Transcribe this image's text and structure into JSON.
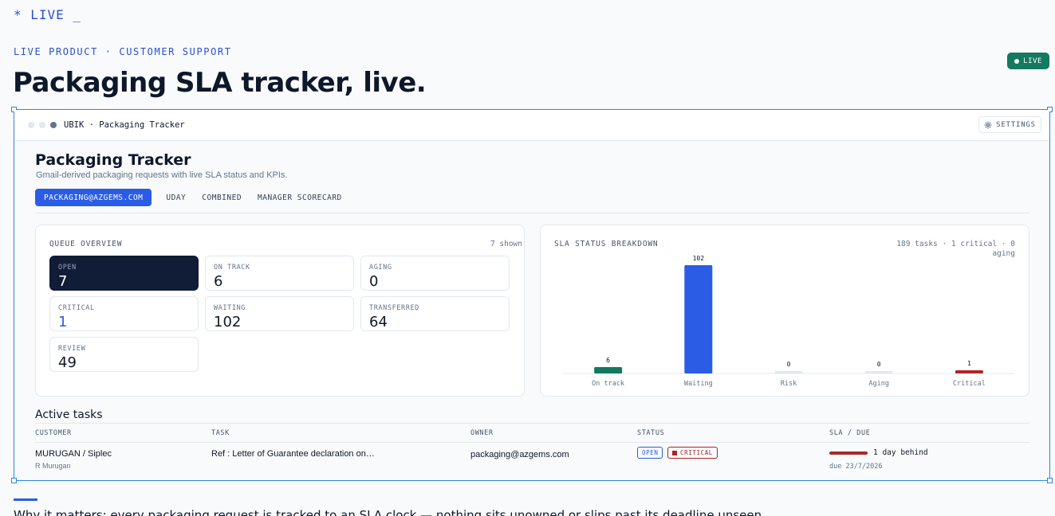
{
  "brand": "* LIVE _",
  "eyebrow": "LIVE PRODUCT · CUSTOMER SUPPORT",
  "page_title": "Packaging SLA tracker, live.",
  "live_badge": "LIVE",
  "app": {
    "name": "UBIK · Packaging Tracker",
    "settings_label": "SETTINGS"
  },
  "tracker": {
    "title": "Packaging Tracker",
    "subtitle": "Gmail-derived packaging requests with live SLA status and KPIs.",
    "tabs": [
      {
        "label": "PACKAGING@AZGEMS.COM",
        "active": true
      },
      {
        "label": "UDAY",
        "active": false
      },
      {
        "label": "COMBINED",
        "active": false
      },
      {
        "label": "MANAGER SCORECARD",
        "active": false
      }
    ]
  },
  "queue": {
    "label": "QUEUE OVERVIEW",
    "shown": "7 shown",
    "kpis": [
      {
        "label": "OPEN",
        "value": "7"
      },
      {
        "label": "ON TRACK",
        "value": "6"
      },
      {
        "label": "AGING",
        "value": "0"
      },
      {
        "label": "CRITICAL",
        "value": "1"
      },
      {
        "label": "WAITING",
        "value": "102"
      },
      {
        "label": "TRANSFERRED",
        "value": "64"
      },
      {
        "label": "REVIEW",
        "value": "49"
      }
    ]
  },
  "sla": {
    "label": "SLA STATUS BREAKDOWN",
    "meta_line1": "189 tasks · 1 critical · 0",
    "meta_line2": "aging"
  },
  "chart_data": {
    "type": "bar",
    "categories": [
      "On track",
      "Waiting",
      "Risk",
      "Aging",
      "Critical"
    ],
    "values": [
      6,
      102,
      0,
      0,
      1
    ],
    "colors": [
      "#14795f",
      "#2a5ce6",
      "#e2e8f0",
      "#e2e8f0",
      "#b42323"
    ],
    "ylim": [
      0,
      102
    ],
    "grid": false
  },
  "tasks": {
    "title": "Active tasks",
    "columns": [
      "CUSTOMER",
      "TASK",
      "OWNER",
      "STATUS",
      "SLA / DUE"
    ],
    "rows": [
      {
        "customer": "MURUGAN / Siplec",
        "contact": "R Murugan",
        "task": "Ref : Letter of Guarantee declaration on…",
        "owner": "packaging@azgems.com",
        "status_open": "OPEN",
        "status_critical": "CRITICAL",
        "sla": "1 day behind",
        "due": "due 23/7/2026"
      }
    ]
  },
  "footer": "Why it matters: every packaging request is tracked to an SLA clock — nothing sits unowned or slips past its deadline unseen.",
  "colors": {
    "accent": "#2a5ce6",
    "live": "#14795f",
    "critical": "#b42323",
    "dark": "#111c36"
  }
}
